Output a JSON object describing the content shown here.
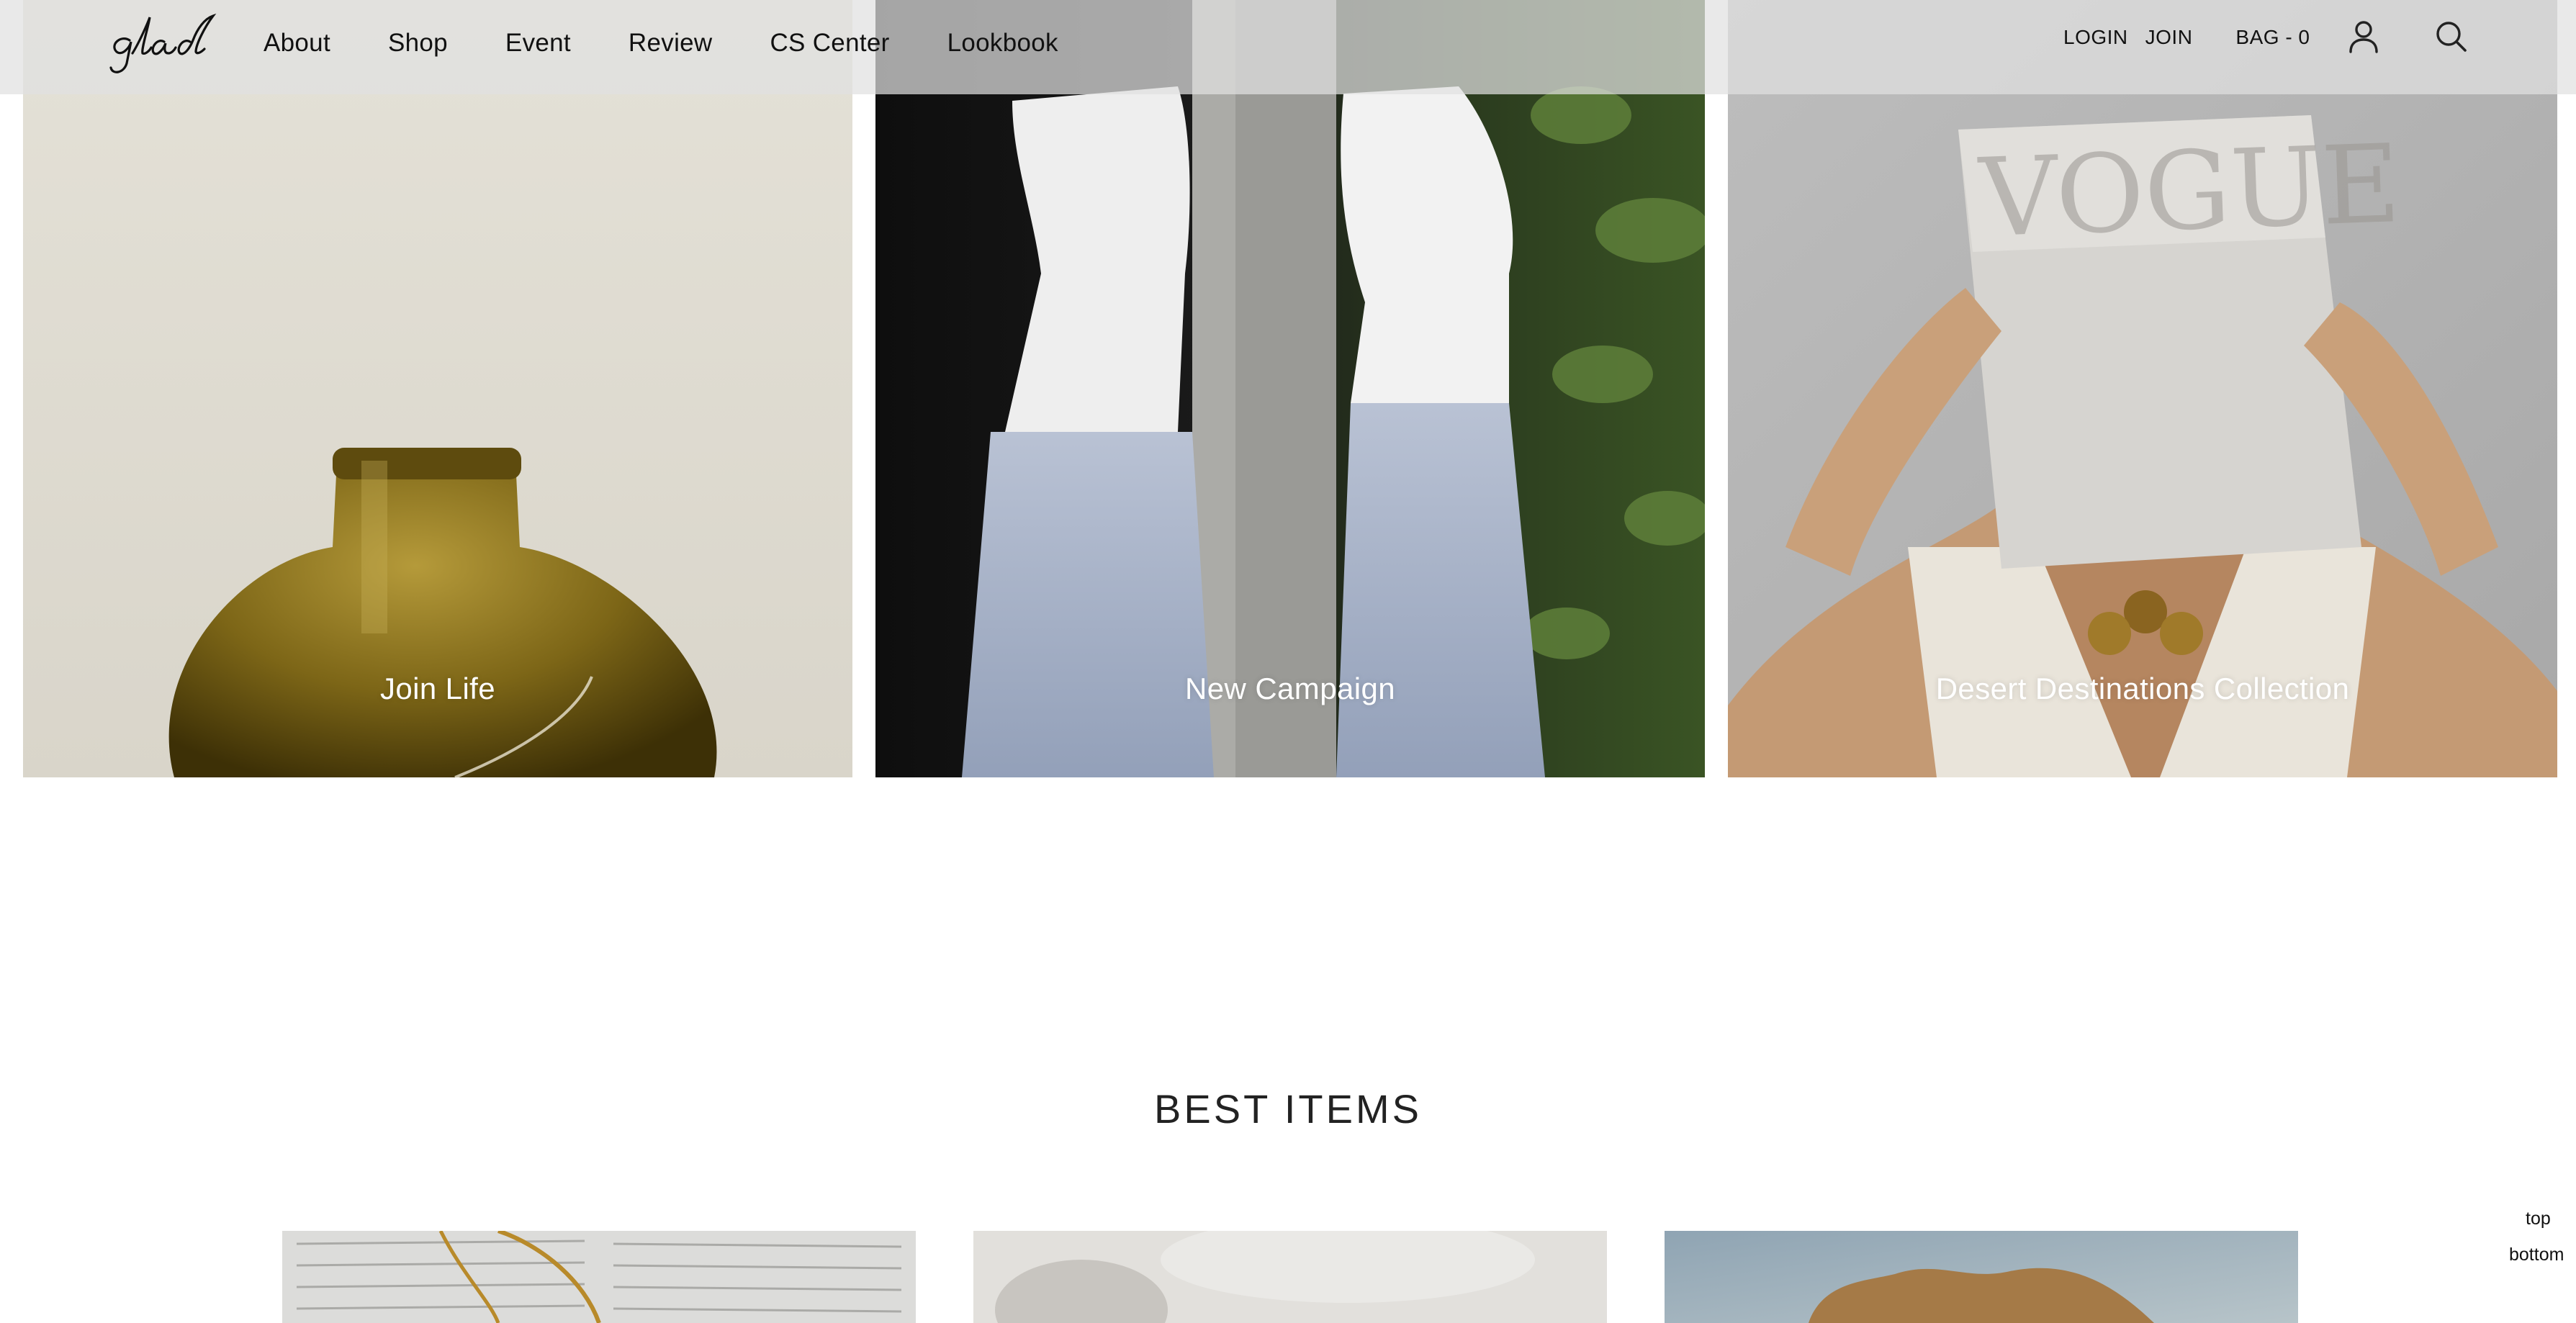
{
  "brand": {
    "logo_text": "glad"
  },
  "nav": {
    "menu": [
      "About",
      "Shop",
      "Event",
      "Review",
      "CS Center",
      "Lookbook"
    ],
    "login": "LOGIN",
    "join": "JOIN",
    "bag": "BAG - 0",
    "icons": {
      "account": "user-icon",
      "search": "search-icon"
    }
  },
  "banners": [
    {
      "label": "Join Life"
    },
    {
      "label": "New Campaign"
    },
    {
      "label": "Desert Destinations Collection"
    }
  ],
  "best_items": {
    "title": "BEST ITEMS",
    "count_visible": 3
  },
  "side_nav": {
    "top": "top",
    "bottom": "bottom"
  }
}
